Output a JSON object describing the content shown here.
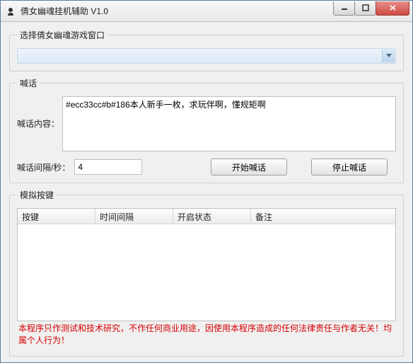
{
  "window": {
    "title": "倩女幽魂挂机辅助 V1.0"
  },
  "group1": {
    "legend": "选择倩女幽魂游戏窗口"
  },
  "group2": {
    "legend": "喊话",
    "content_label": "喊话内容：",
    "content_value": "#ecc33cc#b#186本人新手一枚，求玩伴啊，懂规矩啊",
    "interval_label": "喊话间隔/秒：",
    "interval_value": "4",
    "start_label": "开始喊话",
    "stop_label": "停止喊话"
  },
  "group3": {
    "legend": "模拟按键",
    "columns": {
      "c0": "按键",
      "c1": "时间间隔",
      "c2": "开启状态",
      "c3": "备注"
    }
  },
  "disclaimer": "本程序只作测试和技术研究，不作任何商业用途，因使用本程序造成的任何法律责任与作者无关！均属个人行为！"
}
